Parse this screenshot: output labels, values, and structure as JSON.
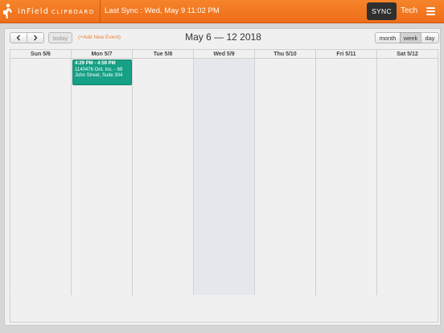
{
  "header": {
    "logo_text": "inField",
    "logo_subtext": "CLIPBOARD",
    "last_sync": "Last Sync : Wed, May 9 11:02 PM",
    "sync_label": "SYNC",
    "user_label": "Tech",
    "accent_color": "#f07a24"
  },
  "toolbar": {
    "prev_label": "<",
    "next_label": ">",
    "today_label": "today",
    "add_event_label": "(+Add New Event)",
    "range_title": "May 6 — 12 2018",
    "view_month": "month",
    "view_week": "week",
    "view_day": "day",
    "active_view": "week"
  },
  "calendar": {
    "days": [
      {
        "label": "Sun 5/6"
      },
      {
        "label": "Mon 5/7"
      },
      {
        "label": "Tue 5/8"
      },
      {
        "label": "Wed 5/9",
        "today": true
      },
      {
        "label": "Thu 5/10"
      },
      {
        "label": "Fri 5/11"
      },
      {
        "label": "Sat 5/12"
      }
    ],
    "events": [
      {
        "day": "Mon 5/7",
        "time": "4:29 PM - 4:59 PM",
        "title": "1140476 Ont. Inc. - 69 John Street, Suite 304",
        "color": "#16a085"
      }
    ]
  }
}
